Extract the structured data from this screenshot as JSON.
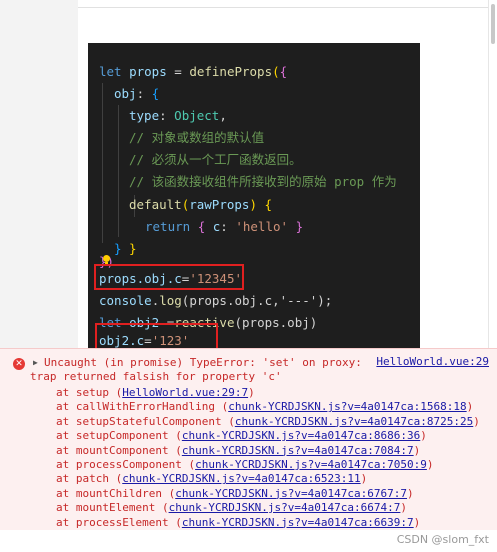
{
  "code": {
    "l1": {
      "kw": "let",
      "var": "props",
      "eq": " = ",
      "fn": "defineProps",
      "p": "(",
      "b": "{"
    },
    "l2": {
      "var": "obj",
      "colon": ":",
      "b": "{"
    },
    "l3": {
      "key": "type",
      "colon": ": ",
      "ty": "Object",
      "comma": ","
    },
    "l4": "// 对象或数组的默认值",
    "l5": "// 必须从一个工厂函数返回。",
    "l6": "// 该函数接收组件所接收到的原始 prop 作为",
    "l7": {
      "fn": "default",
      "p": "(",
      "var": "rawProps",
      "p2": ")",
      "b": "{"
    },
    "l8": {
      "kw": "return",
      "b1": "{",
      "key": "c",
      "colon": ":",
      "str": "'hello'",
      "b2": "}"
    },
    "l9": "}",
    "l10": "}",
    "l11": "})",
    "l12": {
      "var": "props.obj.c",
      "eq": "=",
      "str": "'12345'"
    },
    "l13": {
      "var": "console",
      "fn": "log",
      "args": "(props.obj.c,'---');"
    },
    "l14": {
      "kw": "let",
      "var": "obj2",
      "eq": " =",
      "fn": "reactive",
      "args": "(props.obj)"
    },
    "l15": {
      "var": "obj2.c",
      "eq": "=",
      "str": "'123'"
    }
  },
  "error": {
    "icon": "x-circle-icon",
    "message_line1": "Uncaught (in promise) TypeError: 'set' on proxy:",
    "message_line2": "trap returned falsish for property 'c'",
    "source": "HelloWorld.vue:29",
    "stack": [
      {
        "fn": "at setup",
        "src": "HelloWorld.vue:29:7"
      },
      {
        "fn": "at callWithErrorHandling",
        "src": "chunk-YCRDJSKN.js?v=4a0147ca:1568:18"
      },
      {
        "fn": "at setupStatefulComponent",
        "src": "chunk-YCRDJSKN.js?v=4a0147ca:8725:25"
      },
      {
        "fn": "at setupComponent",
        "src": "chunk-YCRDJSKN.js?v=4a0147ca:8686:36"
      },
      {
        "fn": "at mountComponent",
        "src": "chunk-YCRDJSKN.js?v=4a0147ca:7084:7"
      },
      {
        "fn": "at processComponent",
        "src": "chunk-YCRDJSKN.js?v=4a0147ca:7050:9"
      },
      {
        "fn": "at patch",
        "src": "chunk-YCRDJSKN.js?v=4a0147ca:6523:11"
      },
      {
        "fn": "at mountChildren",
        "src": "chunk-YCRDJSKN.js?v=4a0147ca:6767:7"
      },
      {
        "fn": "at mountElement",
        "src": "chunk-YCRDJSKN.js?v=4a0147ca:6674:7"
      },
      {
        "fn": "at processElement",
        "src": "chunk-YCRDJSKN.js?v=4a0147ca:6639:7"
      }
    ]
  },
  "watermark": "CSDN @slom_fxt",
  "colors": {
    "error": "#c62828",
    "link": "#1a1aa6",
    "highlight_box": "#e02020",
    "editor_bg": "#1e1e1e"
  }
}
